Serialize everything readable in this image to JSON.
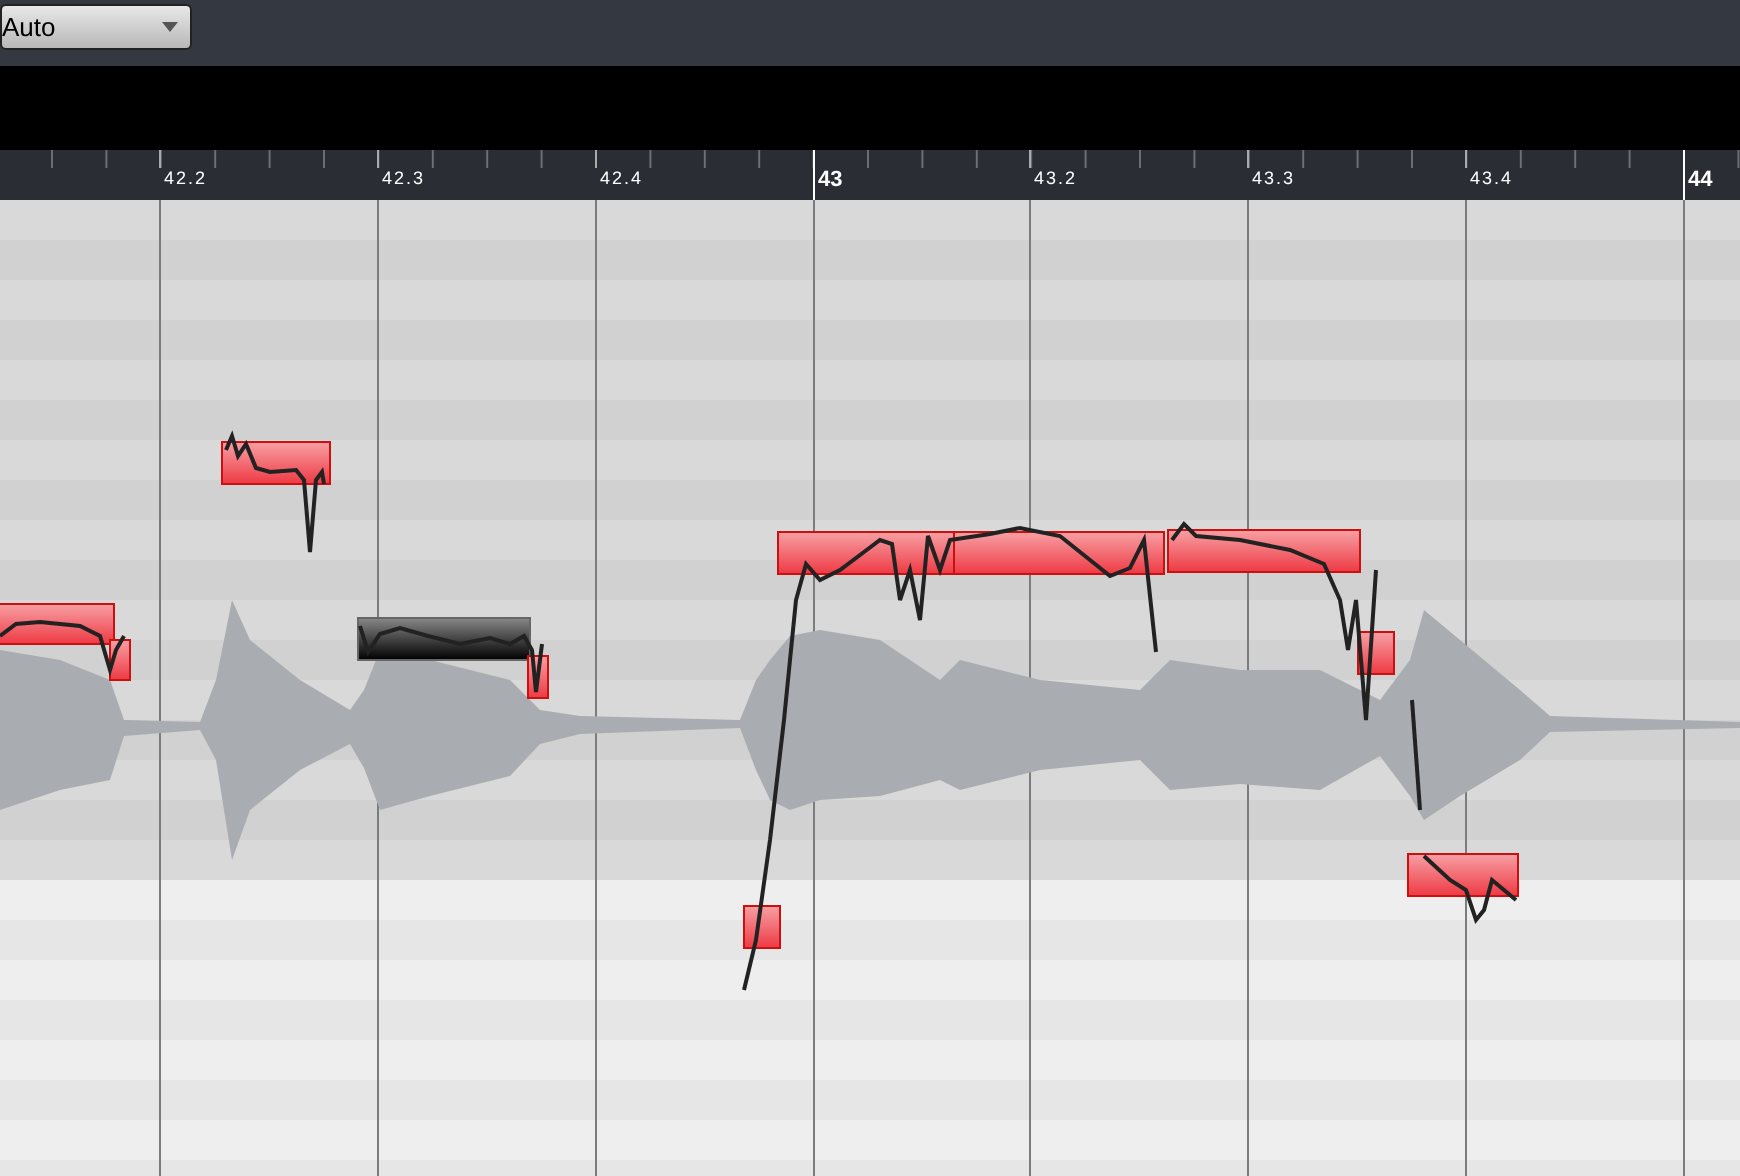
{
  "toolbar": {
    "mode_dropdown": {
      "value": "Auto"
    }
  },
  "ruler": {
    "marks": [
      {
        "label": "42.2",
        "major": false
      },
      {
        "label": "42.3",
        "major": false
      },
      {
        "label": "42.4",
        "major": false
      },
      {
        "label": "43",
        "major": true
      },
      {
        "label": "43.2",
        "major": false
      },
      {
        "label": "43.3",
        "major": false
      },
      {
        "label": "43.4",
        "major": false
      },
      {
        "label": "44",
        "major": true
      }
    ]
  },
  "notes": [
    {
      "selected": false
    },
    {
      "selected": false
    },
    {
      "selected": false
    },
    {
      "selected": true
    },
    {
      "selected": false
    },
    {
      "selected": false
    },
    {
      "selected": false
    },
    {
      "selected": false
    },
    {
      "selected": false
    },
    {
      "selected": false
    },
    {
      "selected": false
    }
  ]
}
